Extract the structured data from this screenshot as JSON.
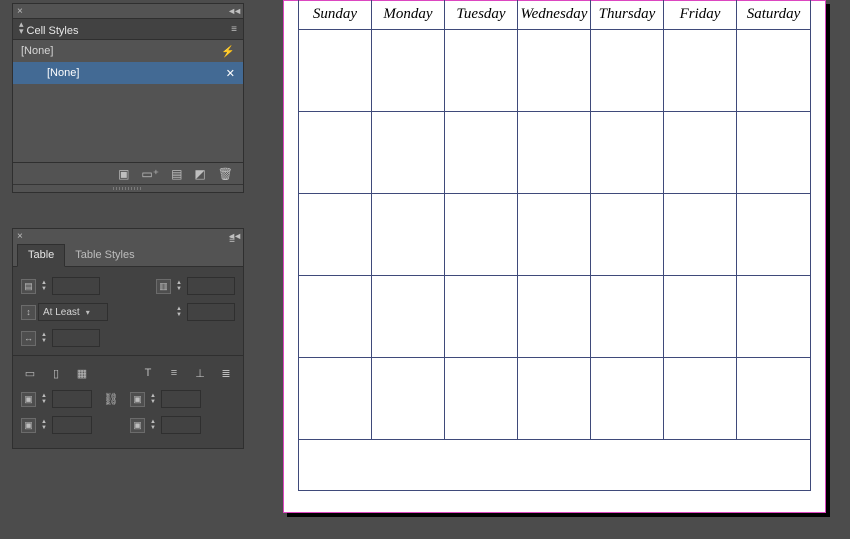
{
  "cellStyles": {
    "title": "Cell Styles",
    "noneHeader": "[None]",
    "items": [
      "[None]"
    ],
    "footerIcons": [
      "folder-icon",
      "new-style-group-icon",
      "table-format-icon",
      "clear-override-icon",
      "trash-icon"
    ]
  },
  "tablePanel": {
    "tabs": [
      "Table",
      "Table Styles"
    ],
    "activeTab": 0,
    "rowHeightMode": "At Least"
  },
  "calendar": {
    "days": [
      "Sunday",
      "Monday",
      "Tuesday",
      "Wednesday",
      "Thursday",
      "Friday",
      "Saturday"
    ],
    "rows": 5,
    "cols": 7
  }
}
